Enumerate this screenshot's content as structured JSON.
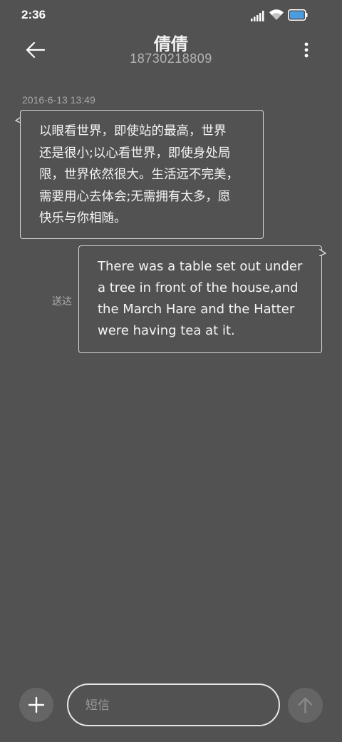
{
  "status_bar": {
    "time": "2:36",
    "icons": [
      "signal-icon",
      "wifi-icon",
      "battery-icon"
    ],
    "battery_color": "#4a9de0"
  },
  "header": {
    "contact_name": "倩倩",
    "contact_number": "18730218809"
  },
  "conversation": {
    "timestamp": "2016-6-13 13:49",
    "messages": [
      {
        "direction": "incoming",
        "lines": [
          "以眼看世界，即使站的最高，世界",
          "还是很小;以心看世界，即使身处局",
          "限，世界依然很大。生活远不完美，",
          "需要用心去体会;无需拥有太多，愿",
          "快乐与你相随。"
        ]
      },
      {
        "direction": "outgoing",
        "lines": [
          "There was a table set out under",
          "a tree in front of the house,and",
          "the March Hare and the Hatter",
          "were having tea at it."
        ],
        "status": "送达"
      }
    ]
  },
  "composer": {
    "placeholder": "短信",
    "value": ""
  }
}
